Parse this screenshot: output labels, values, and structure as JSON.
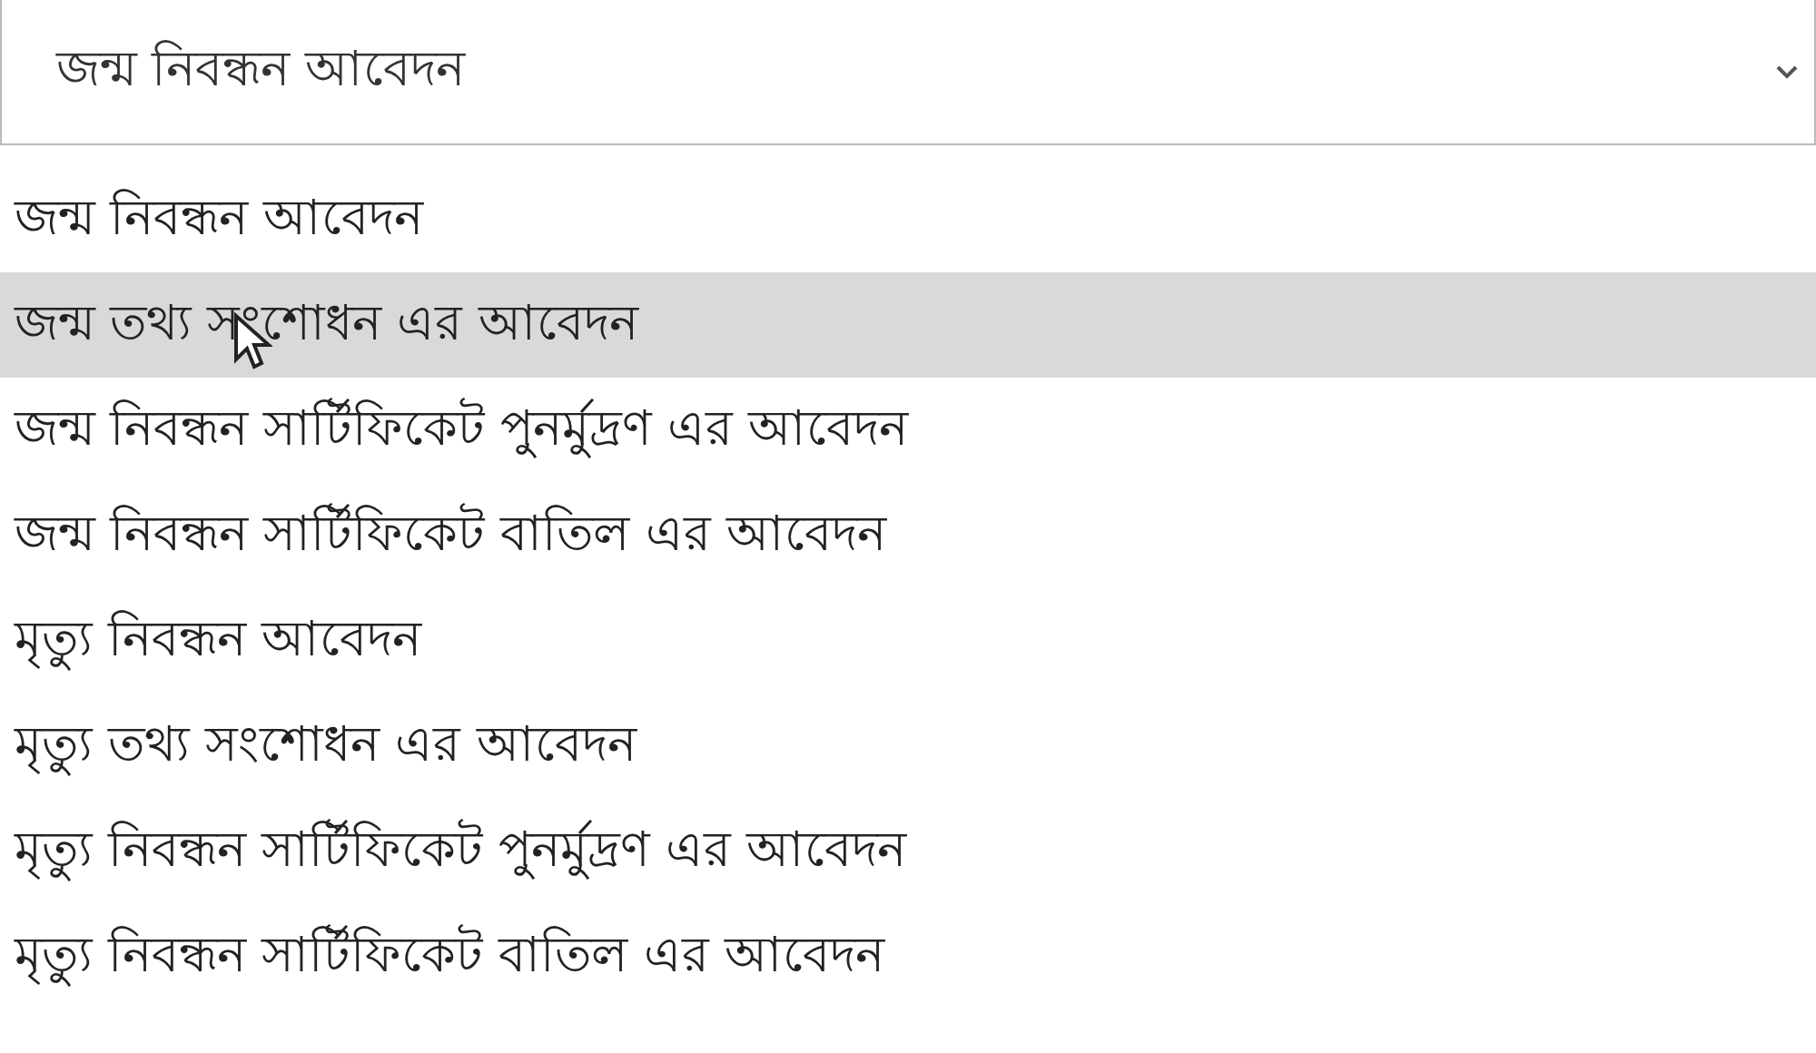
{
  "select": {
    "value": "জন্ম নিবন্ধন আবেদন",
    "expanded": true
  },
  "options": [
    {
      "label": "জন্ম নিবন্ধন আবেদন",
      "selected": false
    },
    {
      "label": "জন্ম তথ্য সংশোধন এর আবেদন",
      "selected": true
    },
    {
      "label": "জন্ম নিবন্ধন সার্টিফিকেট পুনর্মুদ্রণ এর আবেদন",
      "selected": false
    },
    {
      "label": "জন্ম নিবন্ধন সার্টিফিকেট বাতিল এর আবেদন",
      "selected": false
    },
    {
      "label": "মৃত্যু নিবন্ধন আবেদন",
      "selected": false
    },
    {
      "label": "মৃত্যু তথ্য সংশোধন এর আবেদন",
      "selected": false
    },
    {
      "label": "মৃত্যু নিবন্ধন সার্টিফিকেট পুনর্মুদ্রণ এর আবেদন",
      "selected": false
    },
    {
      "label": "মৃত্যু নিবন্ধন সার্টিফিকেট বাতিল এর আবেদন",
      "selected": false
    }
  ]
}
